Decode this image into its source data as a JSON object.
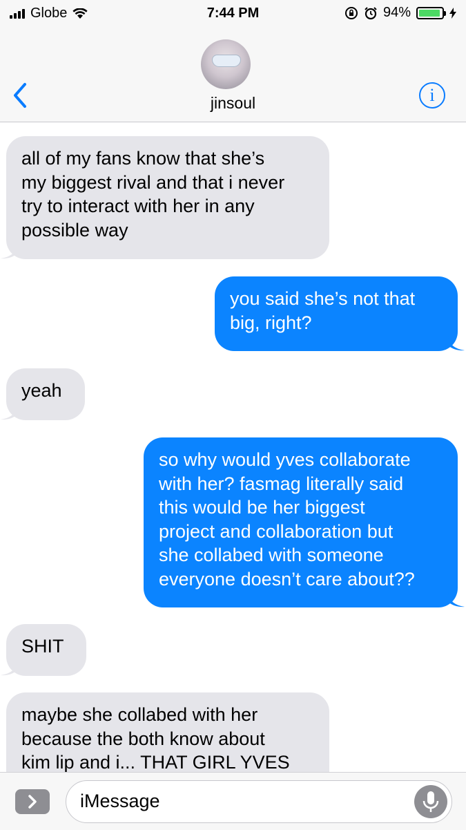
{
  "status_bar": {
    "carrier": "Globe",
    "time": "7:44 PM",
    "battery_percent": "94%",
    "battery_level": 0.94,
    "battery_color": "#4cd964"
  },
  "header": {
    "contact_name": "jinsoul",
    "back_icon": "chevron-left-icon",
    "info_icon": "info-icon",
    "info_glyph": "i",
    "accent_color": "#0a7cff"
  },
  "messages": [
    {
      "direction": "incoming",
      "lines": [
        "all of my fans know that she’s",
        "my biggest rival and that i never",
        "try to interact with her in any",
        "possible way"
      ]
    },
    {
      "direction": "outgoing",
      "lines": [
        "you said she’s not that",
        "big, right?"
      ]
    },
    {
      "direction": "incoming",
      "lines": [
        "yeah"
      ]
    },
    {
      "direction": "outgoing",
      "lines": [
        "so why would yves collaborate",
        "with her? fasmag literally said",
        "this would be her biggest",
        "project and collaboration but",
        "she collabed with someone",
        "everyone doesn’t care about??"
      ]
    },
    {
      "direction": "incoming",
      "lines": [
        "SHIT"
      ]
    },
    {
      "direction": "incoming",
      "lines": [
        "maybe she collabed with her",
        "because the both know about",
        "kim lip and i... THAT GIRL YVES"
      ]
    }
  ],
  "composer": {
    "placeholder": "iMessage",
    "apps_icon": "chevron-right-icon",
    "mic_icon": "microphone-icon"
  },
  "colors": {
    "incoming_bubble": "#e5e5ea",
    "outgoing_bubble": "#0b84ff"
  }
}
